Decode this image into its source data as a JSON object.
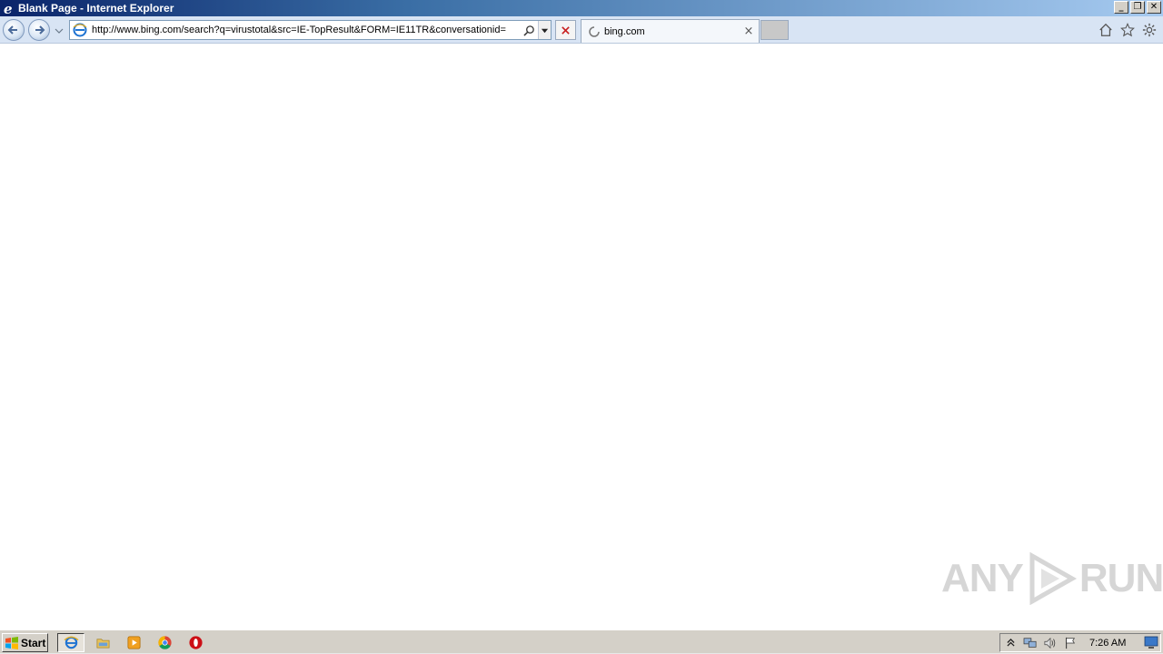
{
  "window": {
    "title": "Blank Page - Internet Explorer",
    "controls": {
      "minimize": "_",
      "restore": "❐",
      "close": "✕"
    }
  },
  "addressbar": {
    "url": "http://www.bing.com/search?q=virustotal&src=IE-TopResult&FORM=IE11TR&conversationid="
  },
  "tabs": [
    {
      "label": "bing.com",
      "loading": true
    }
  ],
  "toolbar_icons": [
    "home-icon",
    "favorites-star-icon",
    "tools-gear-icon"
  ],
  "watermark": {
    "text_left": "ANY",
    "text_right": "RUN"
  },
  "taskbar": {
    "start_label": "Start",
    "apps": [
      "internet-explorer",
      "windows-explorer",
      "media-player",
      "chrome",
      "opera"
    ],
    "clock": "7:26 AM"
  },
  "colors": {
    "titlebar_start": "#0a246a",
    "titlebar_end": "#a6caf0",
    "taskbar": "#d4d0c8",
    "ie_blue": "#1e73d2"
  }
}
